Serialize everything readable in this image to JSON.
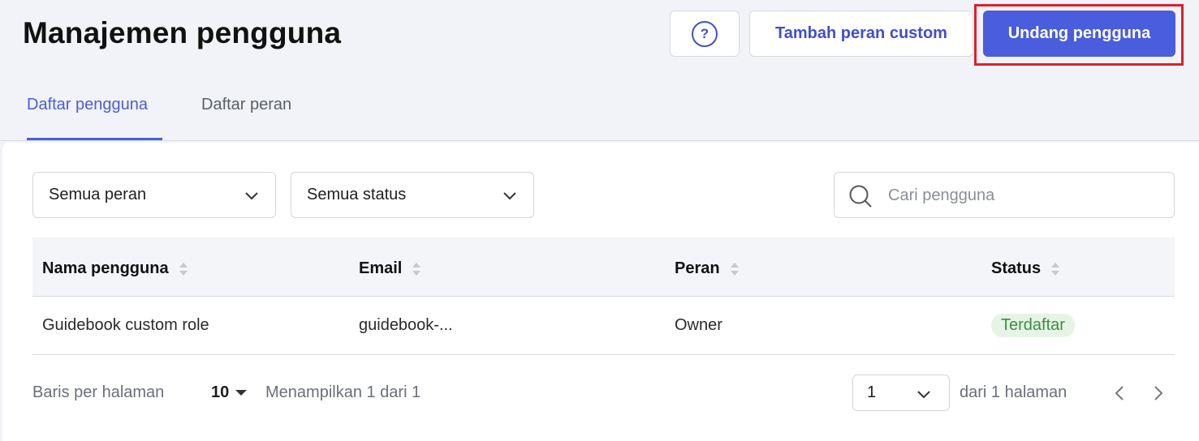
{
  "header": {
    "title": "Manajemen pengguna",
    "help_label": "?",
    "custom_role_label": "Tambah peran custom",
    "invite_label": "Undang pengguna"
  },
  "tabs": [
    {
      "label": "Daftar pengguna",
      "active": true
    },
    {
      "label": "Daftar peran",
      "active": false
    }
  ],
  "filters": {
    "role": "Semua peran",
    "status": "Semua status",
    "search_placeholder": "Cari pengguna"
  },
  "table": {
    "columns": [
      "Nama pengguna",
      "Email",
      "Peran",
      "Status"
    ],
    "rows": [
      {
        "name": "Guidebook custom role",
        "email": "guidebook-...",
        "role": "Owner",
        "status": "Terdaftar"
      }
    ]
  },
  "pagination": {
    "rows_per_page_label": "Baris per halaman",
    "rows_per_page": "10",
    "showing": "Menampilkan 1 dari 1",
    "page": "1",
    "of_pages": "dari 1 halaman"
  },
  "colors": {
    "accent": "#4a5ddc",
    "highlight": "#e0202a",
    "status_green": "#3b8f3e"
  }
}
